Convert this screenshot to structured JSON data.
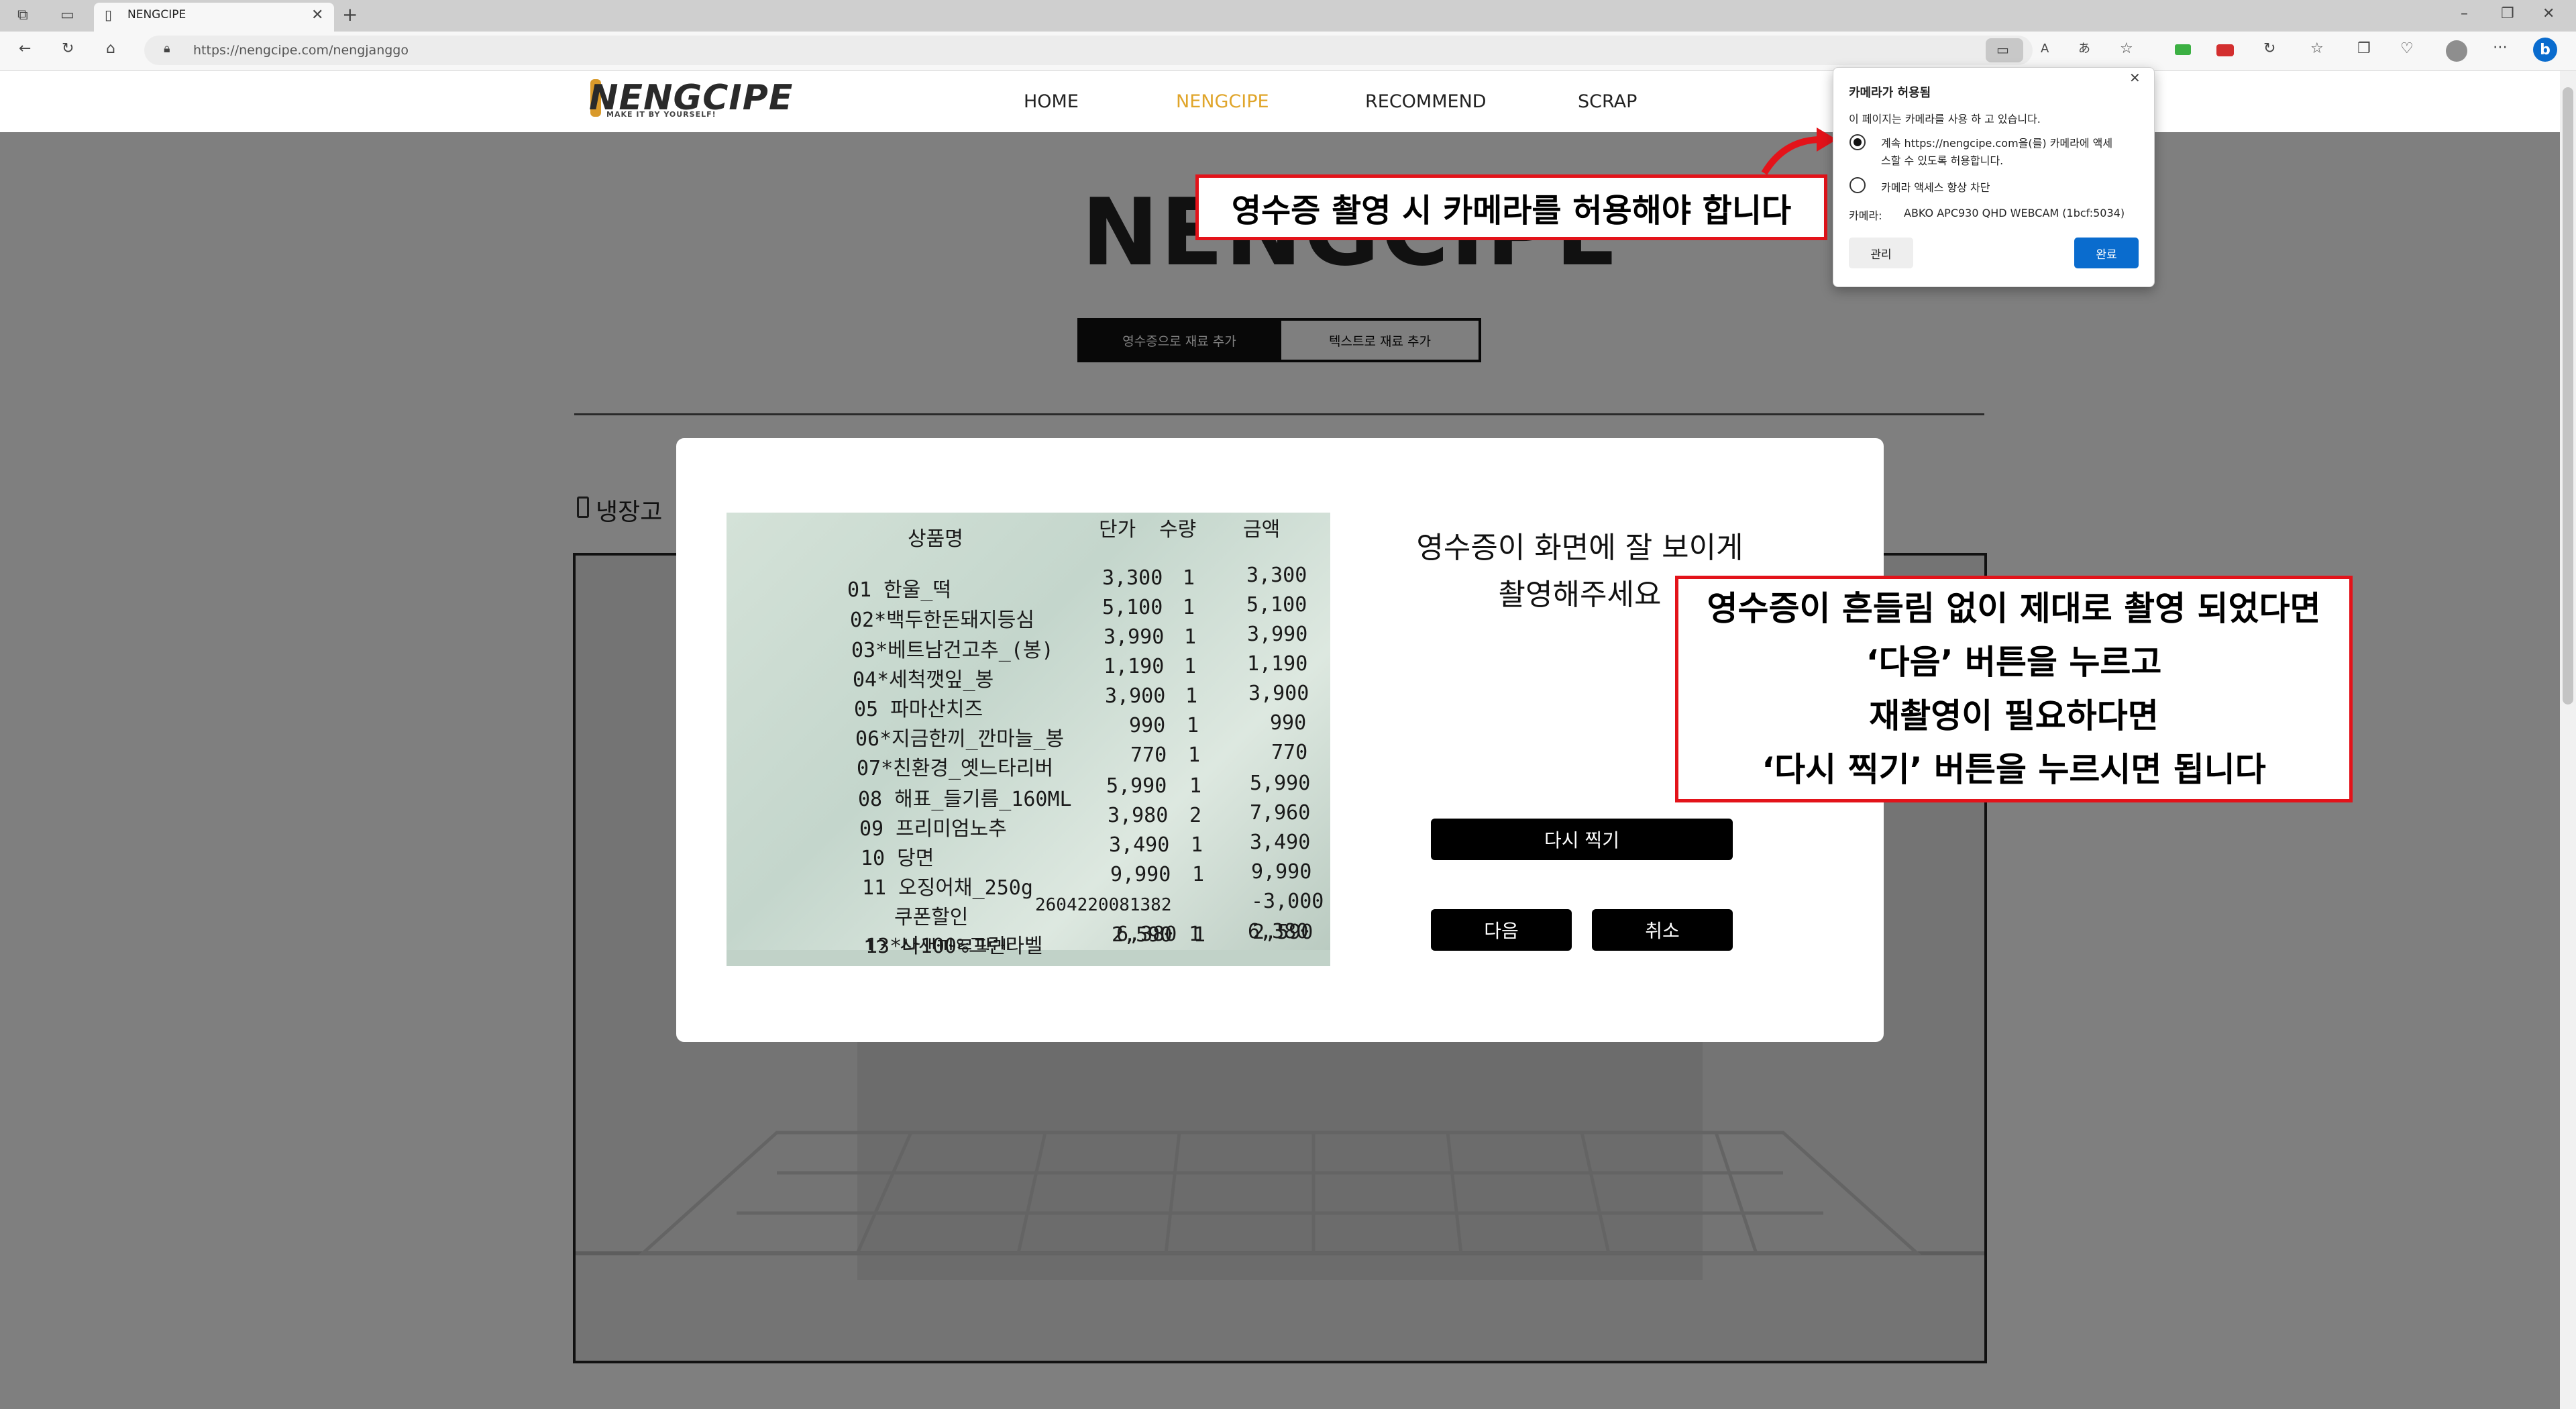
{
  "browser": {
    "tab_title": "NENGCIPE",
    "url": "https://nengcipe.com/nengjanggo"
  },
  "site": {
    "logo": "NENGCIPE",
    "logo_tagline": "MAKE IT BY YOURSELF!",
    "nav": [
      "HOME",
      "NENGCIPE",
      "RECOMMEND",
      "SCRAP"
    ],
    "active_nav": "NENGCIPE",
    "hero_title": "NENGCIPE",
    "seg_receipt": "영수증으로 재료 추가",
    "seg_text": "텍스트로 재료 추가",
    "fridge_label": "냉장고"
  },
  "modal": {
    "message_line1": "영수증이 화면에 잘 보이게",
    "message_line2": "촬영해주세요",
    "retake_label": "다시 찍기",
    "next_label": "다음",
    "cancel_label": "취소",
    "receipt_header": [
      "상품명",
      "단가",
      "수량",
      "금액"
    ],
    "receipt_rows": [
      [
        "01 한울_떡",
        "3,300",
        "1",
        "3,300"
      ],
      [
        "02*백두한돈돼지등심",
        "5,100",
        "1",
        "5,100"
      ],
      [
        "03*베트남건고추_(봉)",
        "3,990",
        "1",
        "3,990"
      ],
      [
        "04*세척깻잎_봉",
        "1,190",
        "1",
        "1,190"
      ],
      [
        "05 파마산치즈",
        "3,900",
        "1",
        "3,900"
      ],
      [
        "06*지금한끼_깐마늘_봉",
        "990",
        "1",
        "990"
      ],
      [
        "07*친환경_옛느타리버",
        "770",
        "1",
        "770"
      ],
      [
        "08 해표_들기름_160ML",
        "5,990",
        "1",
        "5,990"
      ],
      [
        "09 프리미엄노추",
        "3,980",
        "2",
        "7,960"
      ],
      [
        "10 당면",
        "3,490",
        "1",
        "3,490"
      ],
      [
        "11 오징어채_250g",
        "9,990",
        "1",
        "9,990"
      ],
      [
        "쿠폰할인",
        "2604220081382",
        "",
        "-3,000"
      ],
      [
        "12 삼색파르팔레",
        "2,590",
        "1",
        "2,590"
      ],
      [
        "13*나100%그린라벨",
        "6,380",
        "1",
        "6,380"
      ]
    ]
  },
  "callouts": {
    "camera": "영수증 촬영 시 카메라를 허용해야 합니다",
    "instructions": [
      "영수증이 흔들림 없이 제대로 촬영 되었다면",
      "‘다음’ 버튼을 누르고",
      "재촬영이 필요하다면",
      "‘다시 찍기’ 버튼을 누르시면 됩니다"
    ]
  },
  "permission_popup": {
    "title": "카메라가 허용됨",
    "subtitle": "이 페이지는 카메라를 사용 하 고 있습니다.",
    "option_allow_line1": "계속 https://nengcipe.com을(를) 카메라에 액세",
    "option_allow_line2": "스할 수 있도록 허용합니다.",
    "option_block": "카메라 액세스 항상 차단",
    "camera_label": "카메라:",
    "camera_device": "ABKO APC930 QHD WEBCAM (1bcf:5034)",
    "manage_label": "관리",
    "done_label": "완료"
  },
  "colors": {
    "accent_nav": "#e0a52a",
    "callout_border": "#e3131a",
    "edge_blue": "#0a6cce"
  }
}
